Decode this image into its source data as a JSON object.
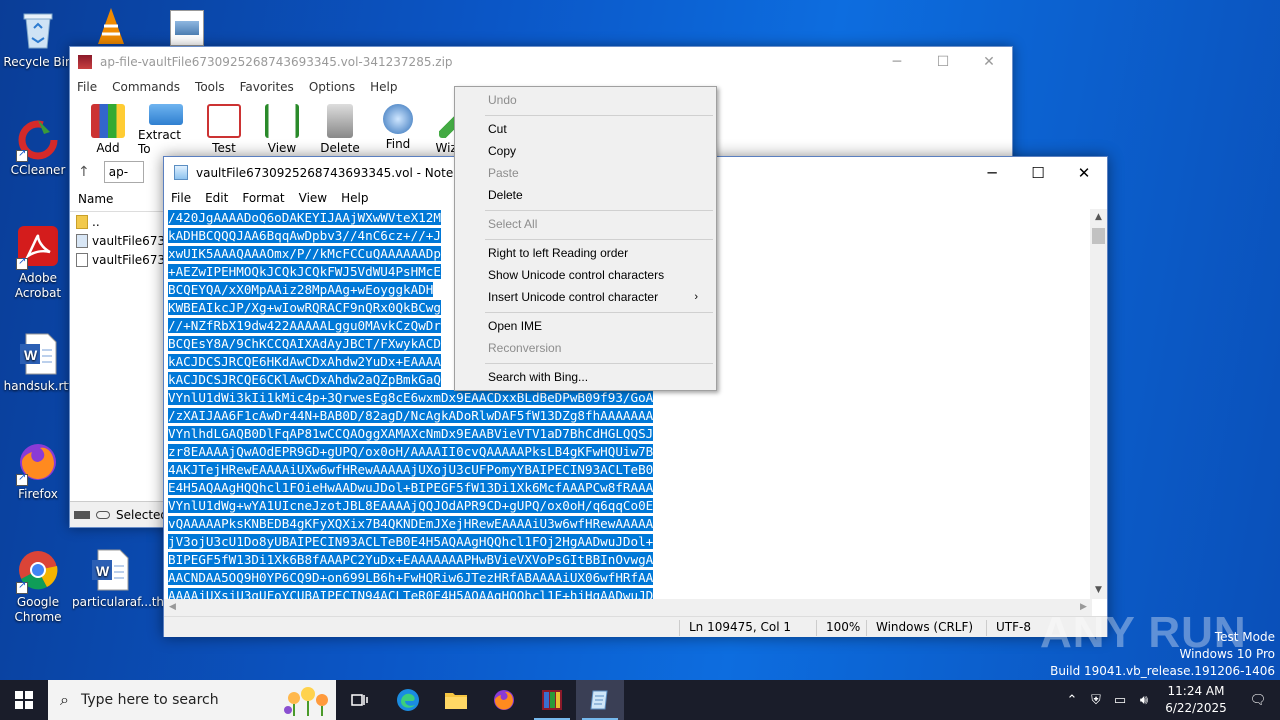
{
  "desktop": {
    "icons": [
      {
        "label": "Recycle Bin",
        "icon": "recycle-bin-icon"
      },
      {
        "label": "CCleaner",
        "icon": "ccleaner-icon"
      },
      {
        "label": "Adobe Acrobat",
        "icon": "adobe-acrobat-icon"
      },
      {
        "label": "handsuk.rtf",
        "icon": "word-document-icon"
      },
      {
        "label": "Firefox",
        "icon": "firefox-icon"
      },
      {
        "label": "Google Chrome",
        "icon": "chrome-icon"
      },
      {
        "label": "particularaf...",
        "icon": "word-document-icon"
      },
      {
        "label": "th",
        "icon": "file-icon"
      }
    ]
  },
  "winrar": {
    "title": "ap-file-vaultFile6730925268743693345.vol-341237285.zip",
    "menu": [
      "File",
      "Commands",
      "Tools",
      "Favorites",
      "Options",
      "Help"
    ],
    "toolbar": [
      "Add",
      "Extract To",
      "Test",
      "View",
      "Delete",
      "Find",
      "Wizard"
    ],
    "address": "ap-",
    "column_name": "Name",
    "files": [
      "..",
      "vaultFile67309",
      "vaultFile67309"
    ],
    "status": "Selected"
  },
  "notepad": {
    "title": "vaultFile6730925268743693345.vol - Notepad",
    "menu": [
      "File",
      "Edit",
      "Format",
      "View",
      "Help"
    ],
    "lines": [
      "/420JgAAAADoQ6oDAKEYIJAAjWXwWVteX12M",
      "kADHBCQQQJAA6BqqAwDpbv3//4nC6cz+//+J",
      "xwUIK5AAAQAAAOmx/P//kMcFCCuQAAAAAADp",
      "+AEZwIPEHMOQkJCQkJCQkFWJ5VdWU4PsHMcE",
      "BCQEYQA/xX0MpAAiz28MpAAg+wEoyggkADH",
      "KWBEAIkcJP/Xg+wIowRQRACF9nQRx0QkBCwg",
      "//+NZfRbX19dw422AAAAALggu0MAvkCzQwDr",
      "BCQEsY8A/9ChKCCQAIXAdAyJBCT/FXwykACD",
      "kACJDCSJRCQE6HKdAwCDxAhdw2YuDx+EAAAA",
      "kACJDCSJRCQE6CKlAwCDxAhdw2aQZpBmkGaQ",
      "VYnlU1dWi3kIi1kMic4p+3QrwesEg8cE6wxmDx9EAACDxxBLdBeDPwB09f93/GoA",
      "/zXAIJAA6F1cAwDr44N+BAB0D/82agD/NcAgkADoRlwDAF5fW13DZg8fhAAAAAAA",
      "VYnlhdLGAQB0DlFqAP81wCCQAOggXAMAXcNmDx9EAABVieVTV1aD7BhCdHGLQQSJ",
      "zr8EAAAAjQwAOdEPR9GD+gUPQ/ox0oH/AAAAII0cvQAAAAAPksLB4gKFwHQUiw7B",
      "4AKJTejHRewEAAAAiUXw6wfHRewAAAAAjUXojU3cUFPomyYBAIPECIN93ACLTeB0",
      "E4H5AQAAgHQQhcl1FOieHwAADwuJDol+BIPEGF5fW13Di1Xk6McfAAAPCw8fRAAA",
      "VYnlU1dWg+wYA1UIcneJzotJBL8EAAAAjQQJOdAPR9CD+gUPQ/ox0oH/q6qqCo0E",
      "vQAAAAAPksKNBEDB4gKFyXQXix7B4QKNDEmJXejHRewEAAAAiU3w6wfHRewAAAAA",
      "jV3ojU3cU1Do8yUBAIPECIN93ACLTeB0E4H5AQAAgHQQhcl1FOj2HgAADwuJDol+",
      "BIPEGF5fW13Di1Xk6B8fAAAPC2YuDx+EAAAAAAAPHwBVieVXVoPsGItBBInOvwgA",
      "AACNDAA5OQ9H0YP6CQ9D+on699LB6h+FwHQRiw6JTezHRfABAAAAiUX06wfHRfAA",
      "AAAAjUXsjU3gUFoYCUBAIPECIN94ACLTeR0E4H5AQAAgHQQhcl1E+hjHgAADwuJD"
    ],
    "status": {
      "position": "Ln 109475, Col 1",
      "zoom": "100%",
      "line_ending": "Windows (CRLF)",
      "encoding": "UTF-8"
    }
  },
  "context_menu": {
    "items": [
      {
        "label": "Undo",
        "enabled": false
      },
      {
        "label": "Cut",
        "enabled": true
      },
      {
        "label": "Copy",
        "enabled": true
      },
      {
        "label": "Paste",
        "enabled": false
      },
      {
        "label": "Delete",
        "enabled": true
      },
      {
        "label": "Select All",
        "enabled": false
      },
      {
        "label": "Right to left Reading order",
        "enabled": true
      },
      {
        "label": "Show Unicode control characters",
        "enabled": true
      },
      {
        "label": "Insert Unicode control character",
        "enabled": true
      },
      {
        "label": "Open IME",
        "enabled": true
      },
      {
        "label": "Reconversion",
        "enabled": false
      },
      {
        "label": "Search with Bing...",
        "enabled": true
      }
    ]
  },
  "watermark": "ANY RUN",
  "sysinfo": {
    "line1": "Test Mode",
    "line2": "Windows 10 Pro",
    "line3": "Build 19041.vb_release.191206-1406"
  },
  "taskbar": {
    "search_placeholder": "Type here to search",
    "time": "11:24 AM",
    "date": "6/22/2025"
  }
}
